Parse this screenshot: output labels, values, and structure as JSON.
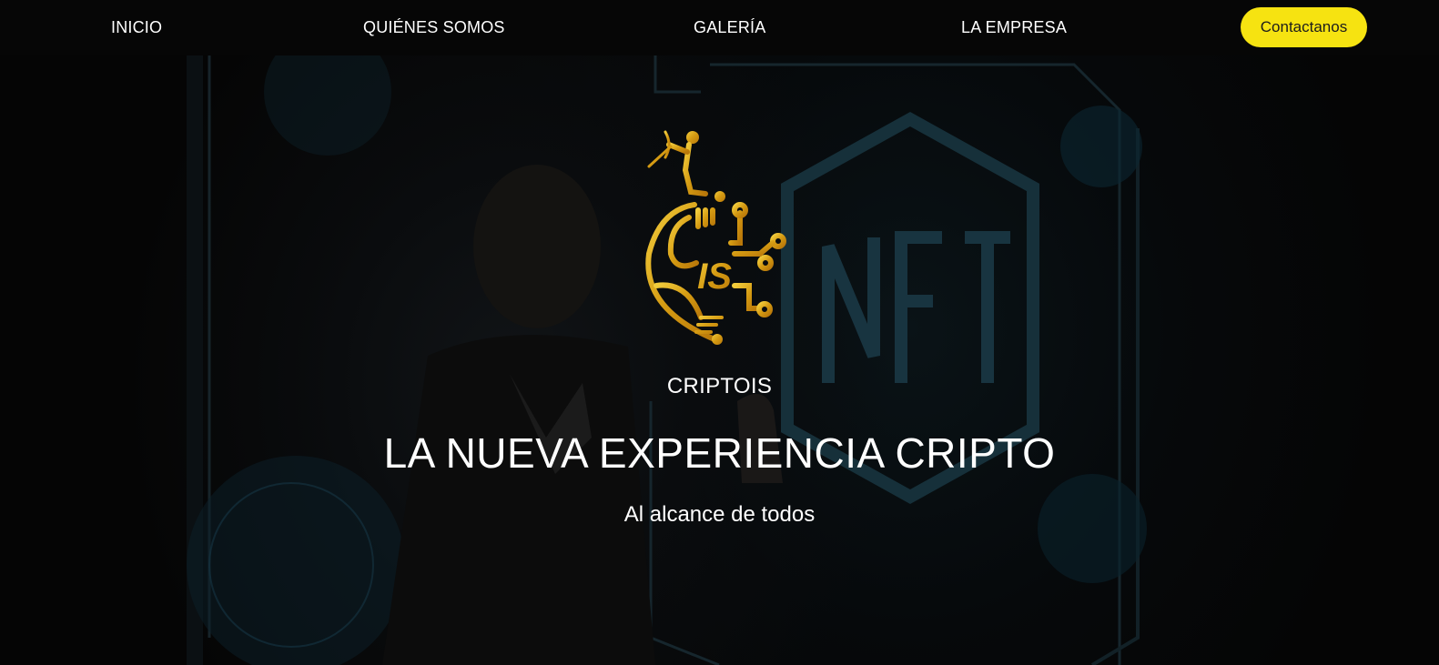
{
  "nav": {
    "items": [
      "INICIO",
      "QUIÉNES SOMOS",
      "GALERÍA",
      "LA EMPRESA"
    ],
    "cta_label": "Contactanos"
  },
  "hero": {
    "logo_text": "IS",
    "brand": "CRIPTOIS",
    "headline": "LA NUEVA EXPERIENCIA CRIPTO",
    "subheadline": "Al alcance de todos",
    "background_icon": "nft-hexagon-icon"
  },
  "colors": {
    "accent": "#f6e311",
    "gold": "#d4a017",
    "background": "#050505",
    "text": "#ffffff"
  }
}
